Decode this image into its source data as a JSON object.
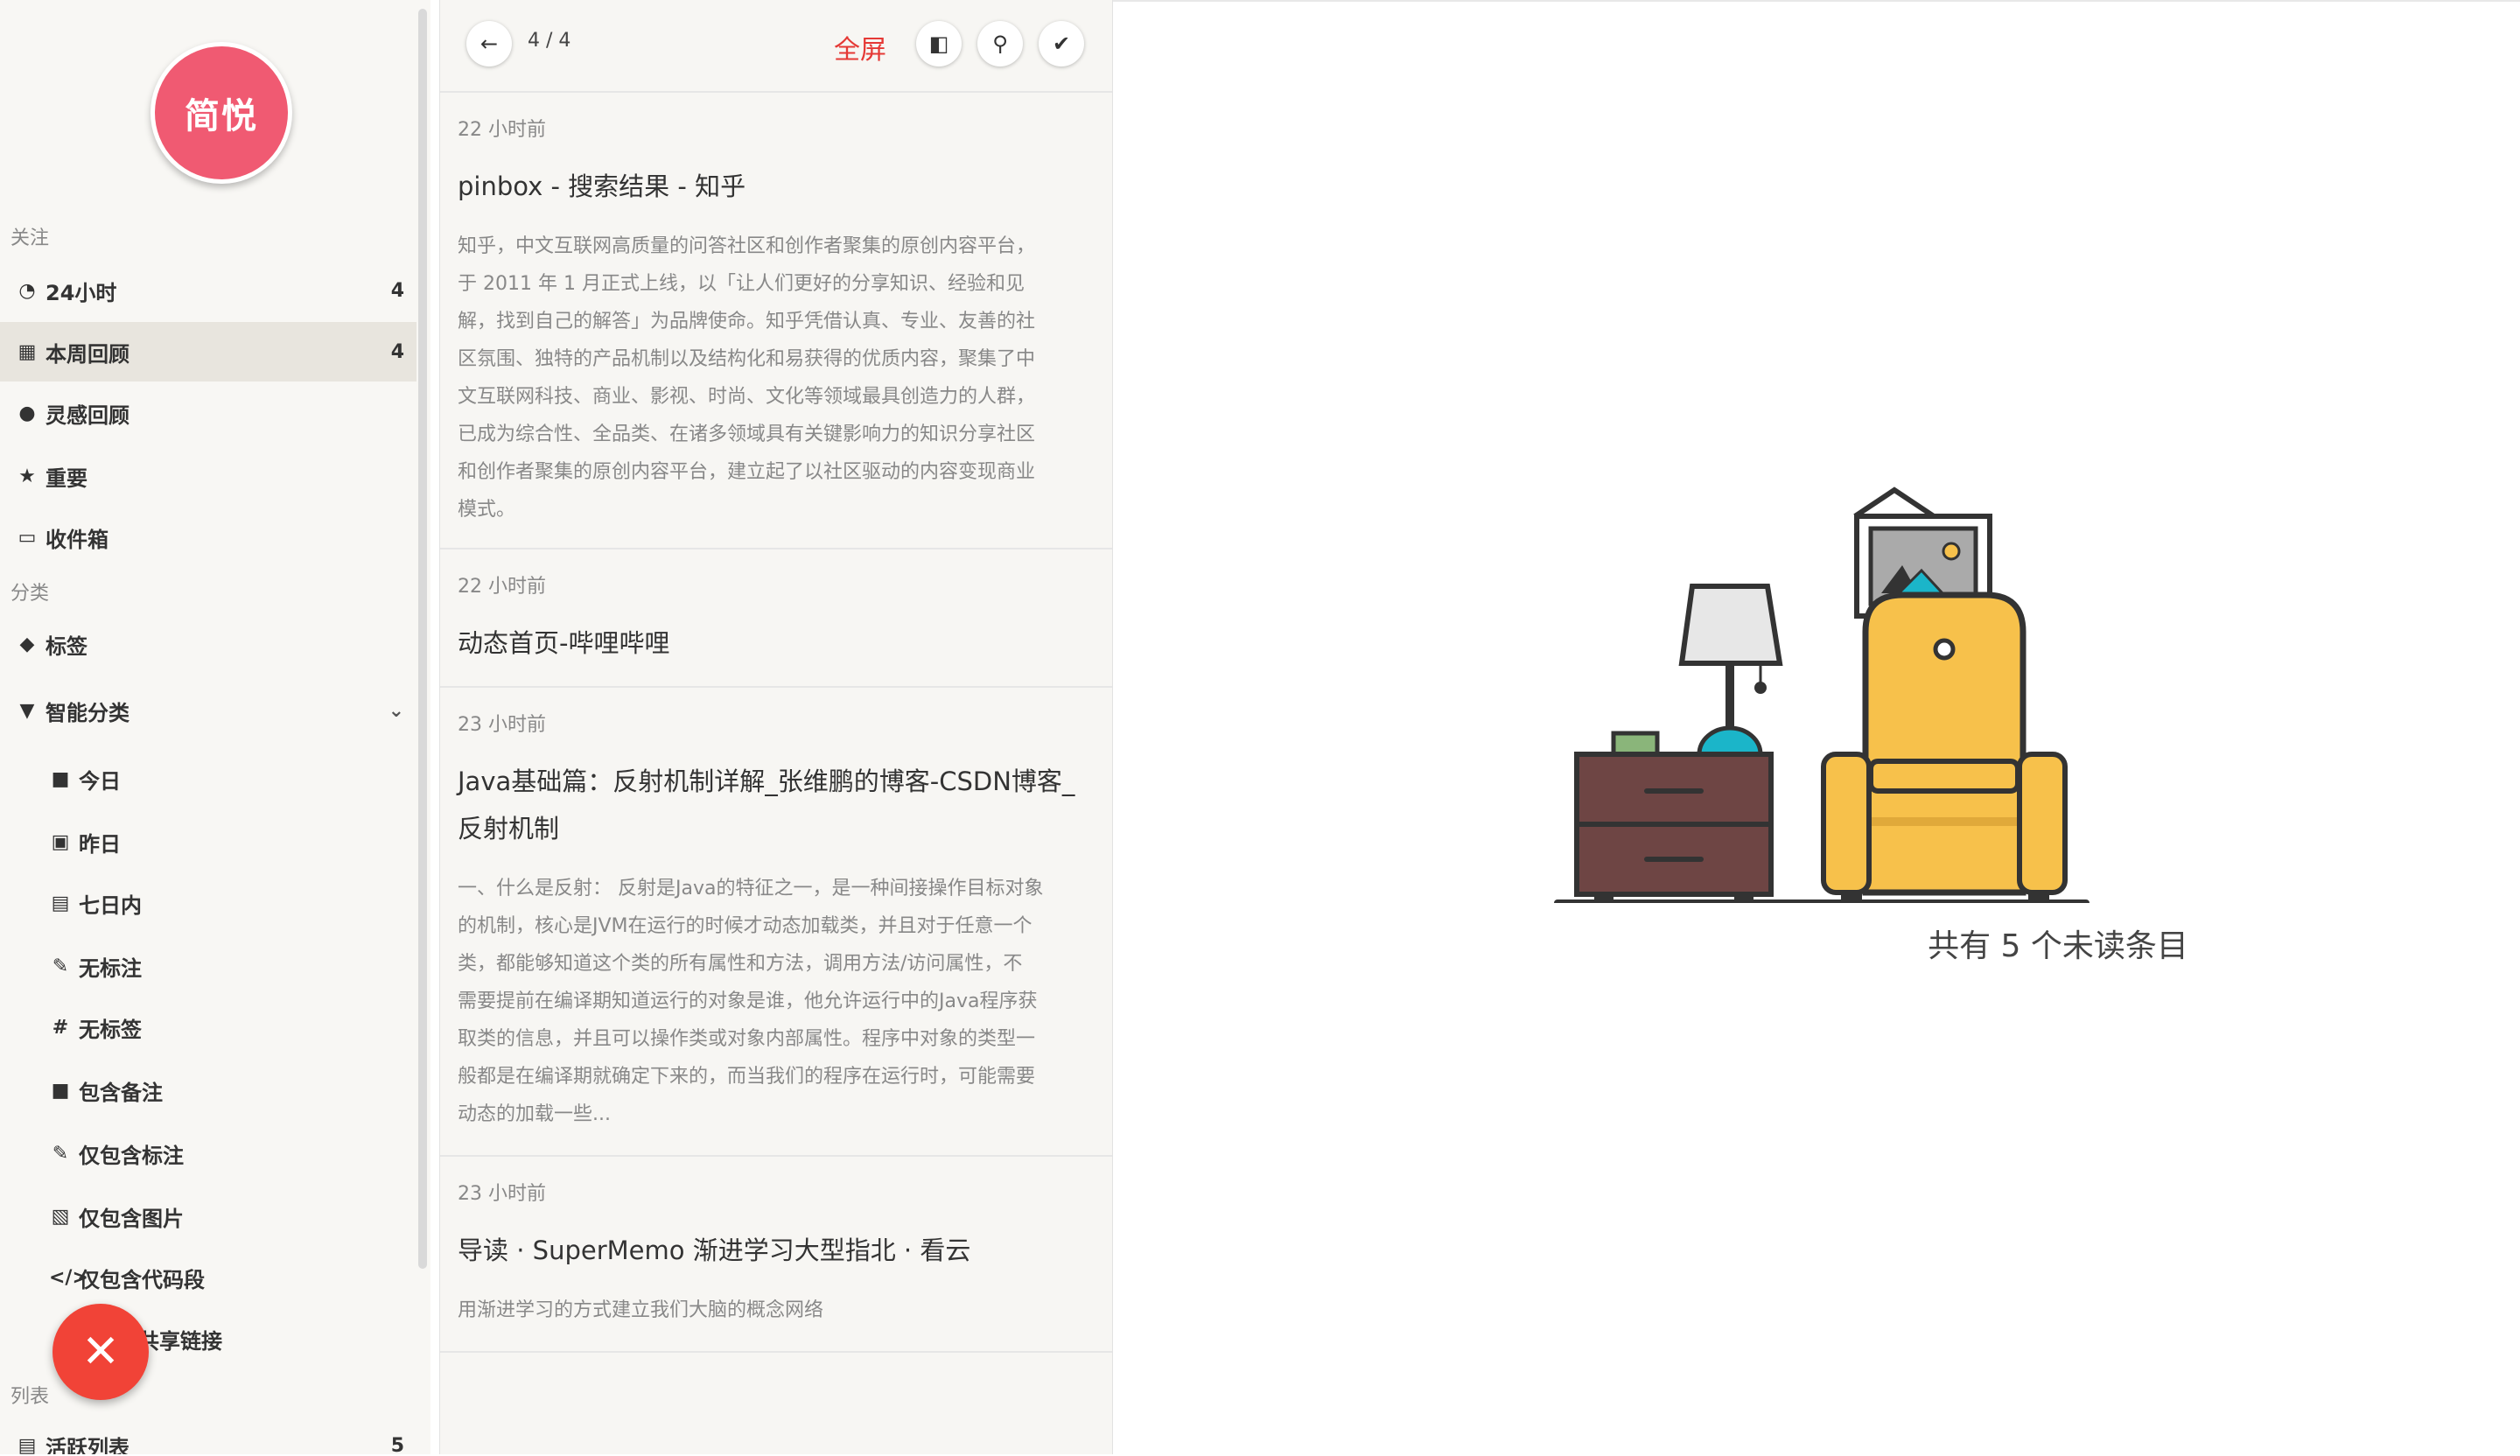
{
  "sidebar": {
    "logo_text": "简悦",
    "sections": {
      "follow": "关注",
      "category": "分类",
      "lists": "列表"
    },
    "follow_items": [
      {
        "label": "24小时",
        "count": "4",
        "icon": "clock-icon"
      },
      {
        "label": "本周回顾",
        "count": "4",
        "icon": "calendar-icon"
      },
      {
        "label": "灵感回顾",
        "count": "",
        "icon": "lightbulb-icon"
      },
      {
        "label": "重要",
        "count": "",
        "icon": "star-icon"
      },
      {
        "label": "收件箱",
        "count": "",
        "icon": "inbox-icon"
      }
    ],
    "category_items": [
      {
        "label": "标签",
        "icon": "tags-icon"
      },
      {
        "label": "智能分类",
        "icon": "filter-icon"
      }
    ],
    "smart_items": [
      {
        "label": "今日",
        "icon": "calendar-day-icon"
      },
      {
        "label": "昨日",
        "icon": "calendar-yesterday-icon"
      },
      {
        "label": "七日内",
        "icon": "calendar-week-icon"
      },
      {
        "label": "无标注",
        "icon": "pen-icon"
      },
      {
        "label": "无标签",
        "icon": "hash-icon"
      },
      {
        "label": "包含备注",
        "icon": "note-icon"
      },
      {
        "label": "仅包含标注",
        "icon": "pen-icon"
      },
      {
        "label": "仅包含图片",
        "icon": "image-icon"
      },
      {
        "label": "仅包含代码段",
        "icon": "code-icon"
      },
      {
        "label": "共享链接",
        "icon": "share-icon"
      }
    ],
    "list_items": [
      {
        "label": "活跃列表",
        "count": "5",
        "icon": "list-icon"
      }
    ]
  },
  "toolbar": {
    "pager": "4 / 4",
    "fullscreen": "全屏"
  },
  "articles": [
    {
      "time": "22 小时前",
      "title": "pinbox - 搜索结果 - 知乎",
      "desc_lines": [
        "知乎，中文互联网高质量的问答社区和创作者聚集的原创内容平台，",
        "于 2011 年 1 月正式上线，以「让人们更好的分享知识、经验和见",
        "解，找到自己的解答」为品牌使命。知乎凭借认真、专业、友善的社",
        "区氛围、独特的产品机制以及结构化和易获得的优质内容，聚集了中",
        "文互联网科技、商业、影视、时尚、文化等领域最具创造力的人群，",
        "已成为综合性、全品类、在诸多领域具有关键影响力的知识分享社区",
        "和创作者聚集的原创内容平台，建立起了以社区驱动的内容变现商业",
        "模式。"
      ]
    },
    {
      "time": "22 小时前",
      "title": "动态首页-哔哩哔哩",
      "desc_lines": []
    },
    {
      "time": "23 小时前",
      "title_lines": [
        "Java基础篇：反射机制详解_张维鹏的博客-CSDN博客_",
        "反射机制"
      ],
      "desc_lines": [
        "一、什么是反射： 反射是Java的特征之一，是一种间接操作目标对象",
        "的机制，核心是JVM在运行的时候才动态加载类，并且对于任意一个",
        "类，都能够知道这个类的所有属性和方法，调用方法/访问属性，不",
        "需要提前在编译期知道运行的对象是谁，他允许运行中的Java程序获",
        "取类的信息，并且可以操作类或对象内部属性。程序中对象的类型一",
        "般都是在编译期就确定下来的，而当我们的程序在运行时，可能需要",
        "动态的加载一些..."
      ]
    },
    {
      "time": "23 小时前",
      "title": "导读 · SuperMemo 渐进学习大型指北 · 看云",
      "desc_lines": [
        "用渐进学习的方式建立我们大脑的概念网络"
      ]
    }
  ],
  "empty_state": {
    "text": "共有 5 个未读条目"
  },
  "colors": {
    "logo": "#f05a72",
    "fab": "#f14337",
    "fullscreen": "#e53935",
    "active_row": "#e8e5de"
  }
}
